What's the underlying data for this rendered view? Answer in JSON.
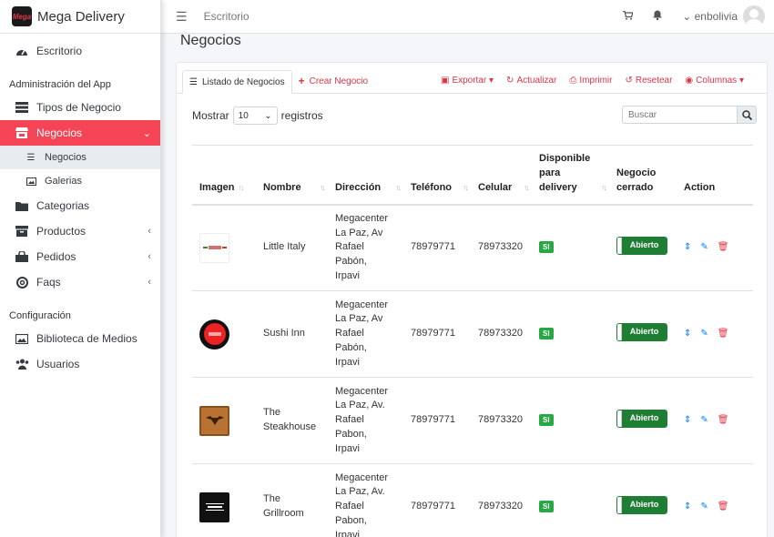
{
  "brand": {
    "name": "Mega Delivery",
    "logo_text": "Mega"
  },
  "topbar": {
    "link": "Escritorio",
    "username": "enbolivia"
  },
  "sidebar": {
    "escritorio": "Escritorio",
    "header_admin": "Administración del App",
    "tipos": "Tipos de Negocio",
    "negocios": "Negocios",
    "sub_negocios": "Negocios",
    "sub_galerias": "Galerias",
    "categorias": "Categorias",
    "productos": "Productos",
    "pedidos": "Pedidos",
    "faqs": "Faqs",
    "header_config": "Configuración",
    "biblioteca": "Biblioteca de Medios",
    "usuarios": "Usuarios"
  },
  "page": {
    "title": "Negocios"
  },
  "tabs": {
    "list": "Listado de Negocios",
    "create": "Crear Negocio"
  },
  "toolbar": {
    "exportar": "Exportar",
    "actualizar": "Actualizar",
    "imprimir": "Imprimir",
    "resetear": "Resetear",
    "columnas": "Columnas"
  },
  "controls": {
    "mostrar": "Mostrar",
    "page_size": "10",
    "registros": "registros",
    "search_placeholder": "Buscar"
  },
  "table": {
    "headers": {
      "imagen": "Imagen",
      "nombre": "Nombre",
      "direccion": "Dirección",
      "telefono": "Teléfono",
      "celular": "Celular",
      "disponible_1": "Disponible",
      "disponible_2": "para",
      "disponible_3": "delivery",
      "cerrado_1": "Negocio",
      "cerrado_2": "cerrado",
      "action": "Action"
    },
    "rows": [
      {
        "nombre_1": "Little Italy",
        "nombre_2": "",
        "dir": [
          "Megacenter",
          "La Paz, Av",
          "Rafael",
          "Pabón,",
          "Irpavi"
        ],
        "telefono": "78979771",
        "celular": "78973320",
        "delivery": "SI",
        "cerrado": "Abierto"
      },
      {
        "nombre_1": "Sushi Inn",
        "nombre_2": "",
        "dir": [
          "Megacenter",
          "La Paz, Av",
          "Rafael",
          "Pabón,",
          "Irpavi"
        ],
        "telefono": "78979771",
        "celular": "78973320",
        "delivery": "SI",
        "cerrado": "Abierto"
      },
      {
        "nombre_1": "The",
        "nombre_2": "Steakhouse",
        "dir": [
          "Megacenter",
          "La Paz, Av.",
          "Rafael",
          "Pabon,",
          "Irpavi"
        ],
        "telefono": "78979771",
        "celular": "78973320",
        "delivery": "SI",
        "cerrado": "Abierto"
      },
      {
        "nombre_1": "The",
        "nombre_2": "Grillroom",
        "dir": [
          "Megacenter",
          "La Paz, Av.",
          "Rafael",
          "Pabon,",
          "Irpavi"
        ],
        "telefono": "78979771",
        "celular": "78973320",
        "delivery": "SI",
        "cerrado": "Abierto"
      }
    ]
  },
  "colors": {
    "accent": "#f44455",
    "danger": "#dc3545",
    "success": "#28a745",
    "toggle": "#1e7e34",
    "primary": "#007bff"
  }
}
